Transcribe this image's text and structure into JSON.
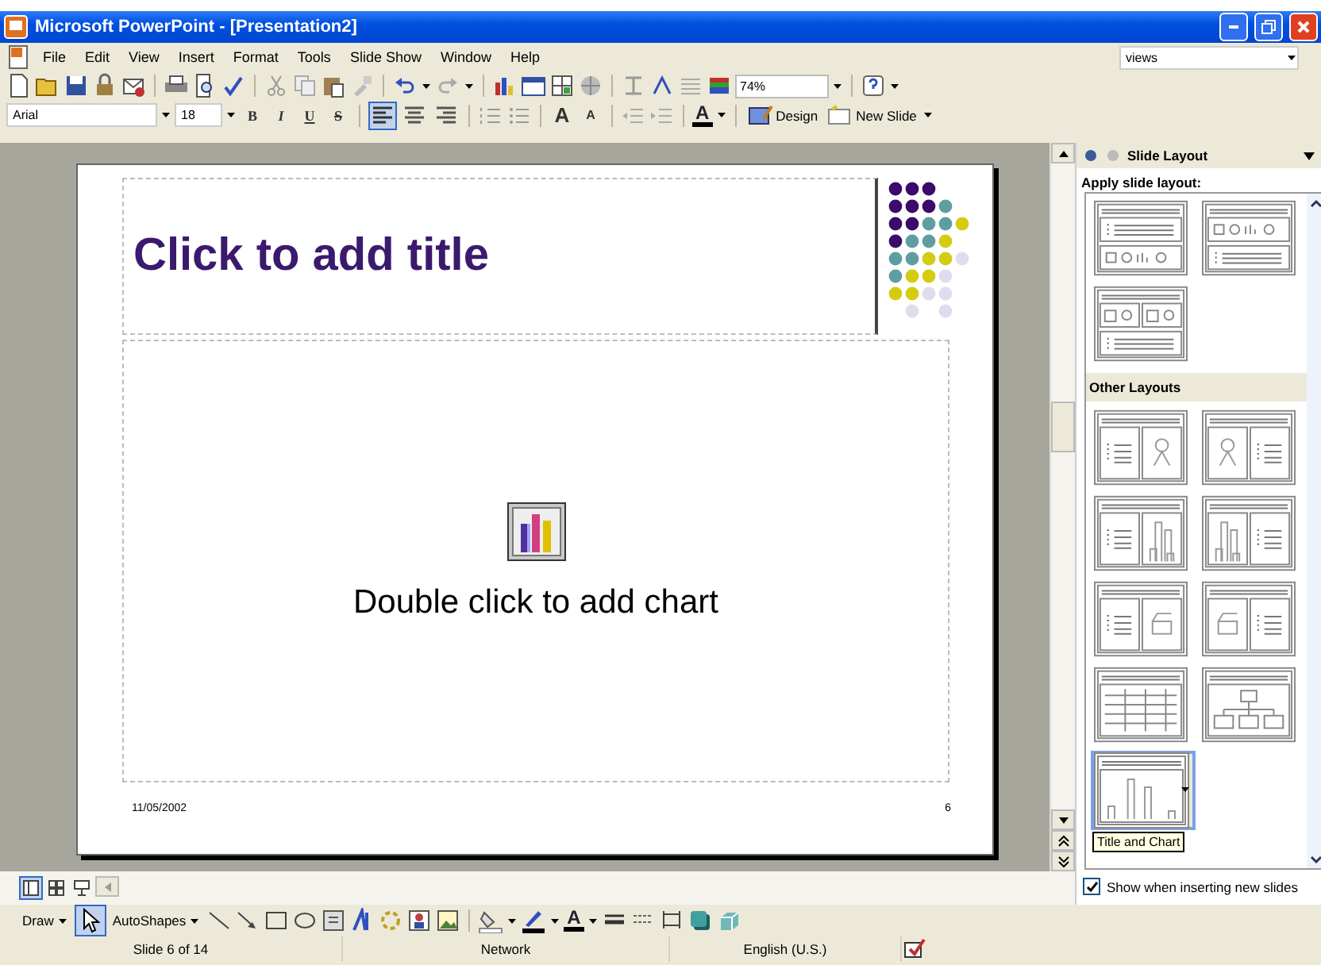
{
  "window": {
    "title": "Microsoft PowerPoint - [Presentation2]"
  },
  "menu": [
    "File",
    "Edit",
    "View",
    "Insert",
    "Format",
    "Tools",
    "Slide Show",
    "Window",
    "Help"
  ],
  "help_box": {
    "value": "views"
  },
  "standard_toolbar": {
    "zoom": "74%"
  },
  "formatting_toolbar": {
    "font": "Arial",
    "size": "18",
    "style_buttons": [
      "B",
      "I",
      "U",
      "S"
    ],
    "alignment_buttons": [
      {
        "kind": "left",
        "selected": true
      },
      {
        "kind": "center",
        "selected": false
      },
      {
        "kind": "right",
        "selected": false
      }
    ],
    "grow_font": "A",
    "shrink_font": "A",
    "font_color": "A",
    "design": "Design",
    "new_slide": "New Slide"
  },
  "slide": {
    "title_placeholder": "Click to add title",
    "chart_placeholder": "Double click to add chart",
    "date": "11/05/2002",
    "page_number": "6"
  },
  "task_pane": {
    "title": "Slide Layout",
    "apply_label": "Apply slide layout:",
    "layouts": [
      {
        "kind": "textcontent",
        "selected": false
      },
      {
        "kind": "contenttext",
        "selected": false
      },
      {
        "kind": "twocontenttext",
        "selected": false
      }
    ],
    "other_heading": "Other Layouts",
    "other_layouts": [
      {
        "kind": "textclipart",
        "selected": false
      },
      {
        "kind": "cliparttext",
        "selected": false
      },
      {
        "kind": "textchart",
        "selected": false
      },
      {
        "kind": "charttext",
        "selected": false
      },
      {
        "kind": "textmedia",
        "selected": false
      },
      {
        "kind": "mediatext",
        "selected": false
      },
      {
        "kind": "table",
        "selected": false
      },
      {
        "kind": "orgchart",
        "selected": false
      },
      {
        "kind": "chart",
        "selected": true
      }
    ],
    "tooltip": "Title and Chart",
    "show_checkbox": {
      "label": "Show when inserting new slides",
      "checked": true
    }
  },
  "view_buttons": [
    {
      "kind": "normal",
      "selected": true
    },
    {
      "kind": "sorter",
      "selected": false
    },
    {
      "kind": "show",
      "selected": false
    }
  ],
  "drawing_toolbar": {
    "draw": "Draw",
    "autoshapes": "AutoShapes",
    "font_color": "A"
  },
  "status_bar": [
    "Slide 6 of 14",
    "Network",
    "English (U.S.)"
  ]
}
